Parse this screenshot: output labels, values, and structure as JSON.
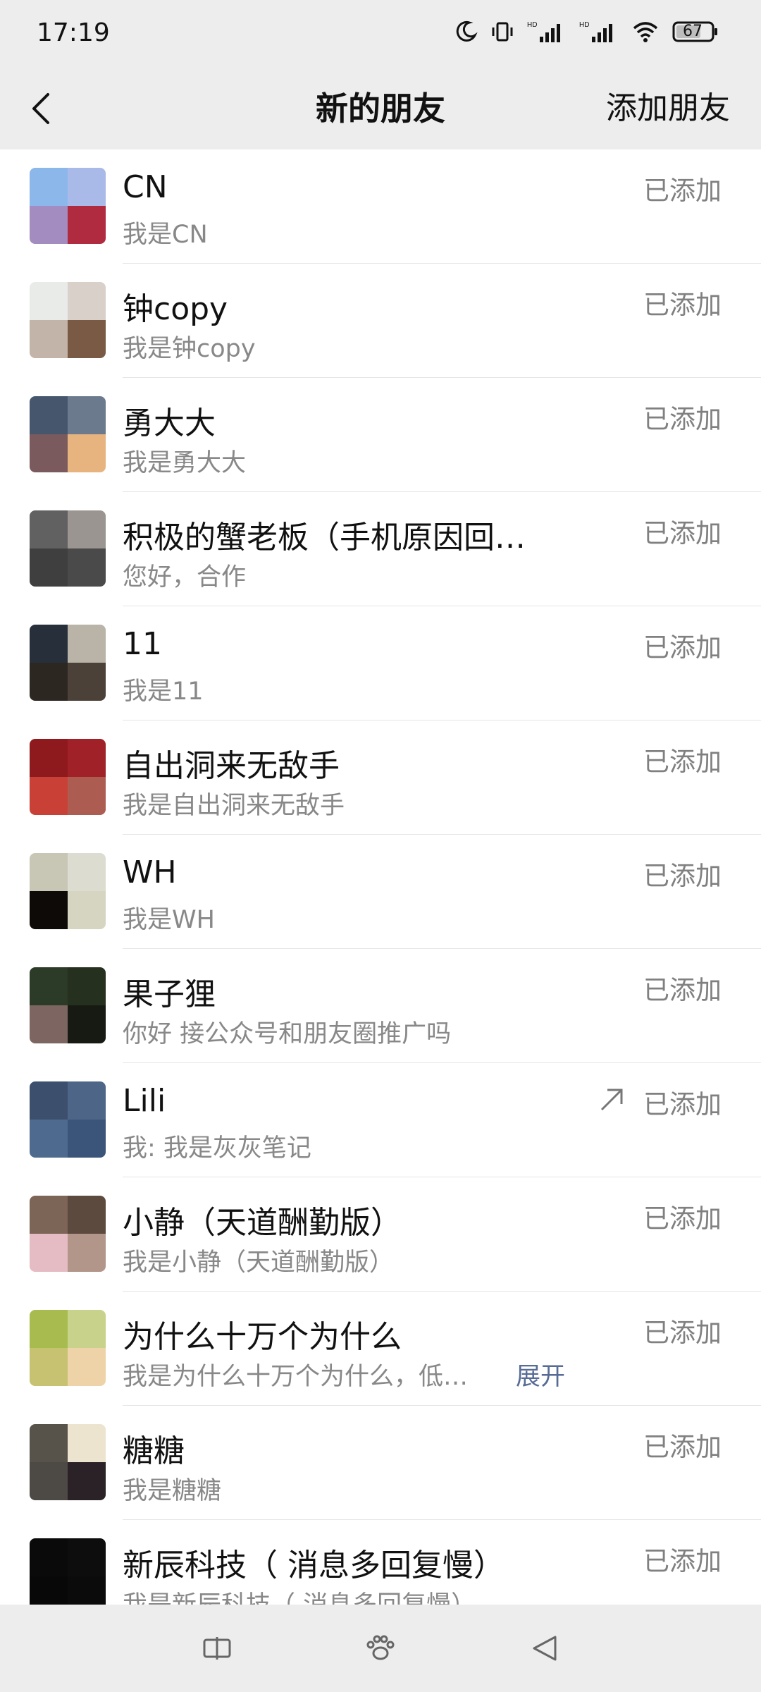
{
  "status_bar": {
    "time": "17:19",
    "battery": "67",
    "network_label_1": "HD",
    "network_label_2": "HD"
  },
  "nav": {
    "title": "新的朋友",
    "action": "添加朋友"
  },
  "friends": [
    {
      "name": "CN",
      "message": "我是CN",
      "status": "已添加",
      "colors": [
        "#8cb7ea",
        "#a9b9e8",
        "#a28cc0",
        "#b02a40"
      ]
    },
    {
      "name": "钟copy",
      "message": "我是钟copy",
      "status": "已添加",
      "colors": [
        "#e9ebe8",
        "#d8d0c9",
        "#c2b4a9",
        "#7a5a44"
      ]
    },
    {
      "name": "勇大大",
      "message": "我是勇大大",
      "status": "已添加",
      "colors": [
        "#46566d",
        "#6c7a8e",
        "#7b5a5e",
        "#e7b47f"
      ]
    },
    {
      "name": "积极的蟹老板（手机原因回…",
      "message": "您好，合作",
      "status": "已添加",
      "colors": [
        "#616161",
        "#9a9590",
        "#3f3f3f",
        "#4a4a4a"
      ]
    },
    {
      "name": "11",
      "message": "我是11",
      "status": "已添加",
      "colors": [
        "#27303a",
        "#b9b3a8",
        "#2d2722",
        "#4b4138"
      ]
    },
    {
      "name": "自出洞来无敌手",
      "message": "我是自出洞来无敌手",
      "status": "已添加",
      "colors": [
        "#8f1a1d",
        "#a02228",
        "#c94136",
        "#ad5c52"
      ]
    },
    {
      "name": "WH",
      "message": "我是WH",
      "status": "已添加",
      "colors": [
        "#c8c6b5",
        "#dcdcd0",
        "#0e0a08",
        "#d6d5c2"
      ]
    },
    {
      "name": "果子狸",
      "message": "你好 接公众号和朋友圈推广吗",
      "status": "已添加",
      "colors": [
        "#2c3a28",
        "#26301f",
        "#7d6661",
        "#161a12"
      ]
    },
    {
      "name": "Lili",
      "message": "我: 我是灰灰笔记",
      "status": "已添加",
      "colors": [
        "#3c4f6c",
        "#4d6688",
        "#4f6a8f",
        "#3a547a"
      ]
    },
    {
      "name": "小静（天道酬勤版）",
      "message": "我是小静（天道酬勤版）",
      "status": "已添加",
      "colors": [
        "#7c6456",
        "#5d4a3f",
        "#e5bcc4",
        "#b3968a"
      ]
    },
    {
      "name": "为什么十万个为什么",
      "message": "我是为什么十万个为什么，低…",
      "expand": "展开",
      "status": "已添加",
      "colors": [
        "#a8bb4e",
        "#c8d28a",
        "#c6c271",
        "#efd3a8"
      ]
    },
    {
      "name": "糖糖",
      "message": "我是糖糖",
      "status": "已添加",
      "colors": [
        "#57524a",
        "#ece4cf",
        "#4d4a46",
        "#2a2226"
      ]
    },
    {
      "name": "新辰科技（ 消息多回复慢）",
      "message": "我是新辰科技（ 消息多回复慢）",
      "status": "已添加",
      "colors": [
        "#0a0a0a",
        "#0d0d0d",
        "#080808",
        "#0b0b0b"
      ]
    }
  ],
  "icons": {
    "back": "chevron-left-icon",
    "share": "arrow-up-right-icon",
    "recent_apps": "recent-apps-icon",
    "home": "paw-home-icon",
    "nav_back": "triangle-back-icon"
  }
}
